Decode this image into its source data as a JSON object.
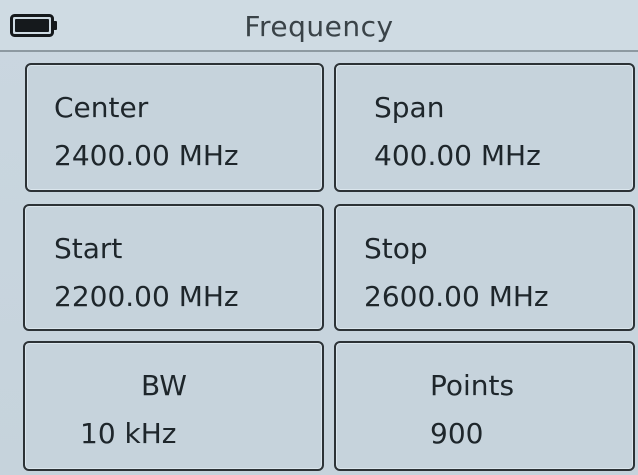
{
  "header": {
    "title": "Frequency",
    "battery_icon": "battery-icon"
  },
  "tiles": {
    "center": {
      "label": "Center",
      "value": "2400.00 MHz"
    },
    "span": {
      "label": "Span",
      "value": "400.00 MHz"
    },
    "start": {
      "label": "Start",
      "value": "2200.00 MHz"
    },
    "stop": {
      "label": "Stop",
      "value": "2600.00 MHz"
    },
    "bw": {
      "label": "BW",
      "value": "10 kHz"
    },
    "points": {
      "label": "Points",
      "value": "900"
    }
  }
}
